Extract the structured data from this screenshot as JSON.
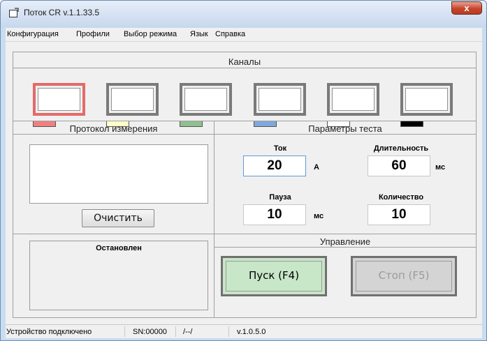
{
  "window": {
    "title": "Поток CR v.1.1.33.5",
    "close_label": "x"
  },
  "menu": {
    "items": [
      "Конфигурация",
      "Профили",
      "Выбор режима",
      "Язык",
      "Справка"
    ]
  },
  "channels": {
    "title": "Каналы",
    "items": [
      {
        "color": "#f08080",
        "active": true
      },
      {
        "color": "#ffffc8",
        "active": false
      },
      {
        "color": "#90c090",
        "active": false
      },
      {
        "color": "#7fa8dc",
        "active": false
      },
      {
        "color": "#ffffff",
        "active": false
      },
      {
        "color": "#000000",
        "active": false
      }
    ]
  },
  "protocol": {
    "title": "Протокол измерения",
    "clear_label": "Очистить",
    "status": "Остановлен"
  },
  "params": {
    "title": "Параметры теста",
    "current": {
      "label": "Ток",
      "value": "20",
      "unit": "А"
    },
    "duration": {
      "label": "Длительность",
      "value": "60",
      "unit": "мс"
    },
    "pause": {
      "label": "Пауза",
      "value": "10",
      "unit": "мс"
    },
    "count": {
      "label": "Количество",
      "value": "10"
    }
  },
  "control": {
    "title": "Управление",
    "start_label": "Пуск (F4)",
    "stop_label": "Стоп (F5)",
    "start_color": "#c8e6c8",
    "stop_color": "#d4d4d4"
  },
  "statusbar": {
    "connection": "Устройство подключено",
    "serial": "SN:00000",
    "path": "/--/",
    "version": "v.1.0.5.0"
  }
}
